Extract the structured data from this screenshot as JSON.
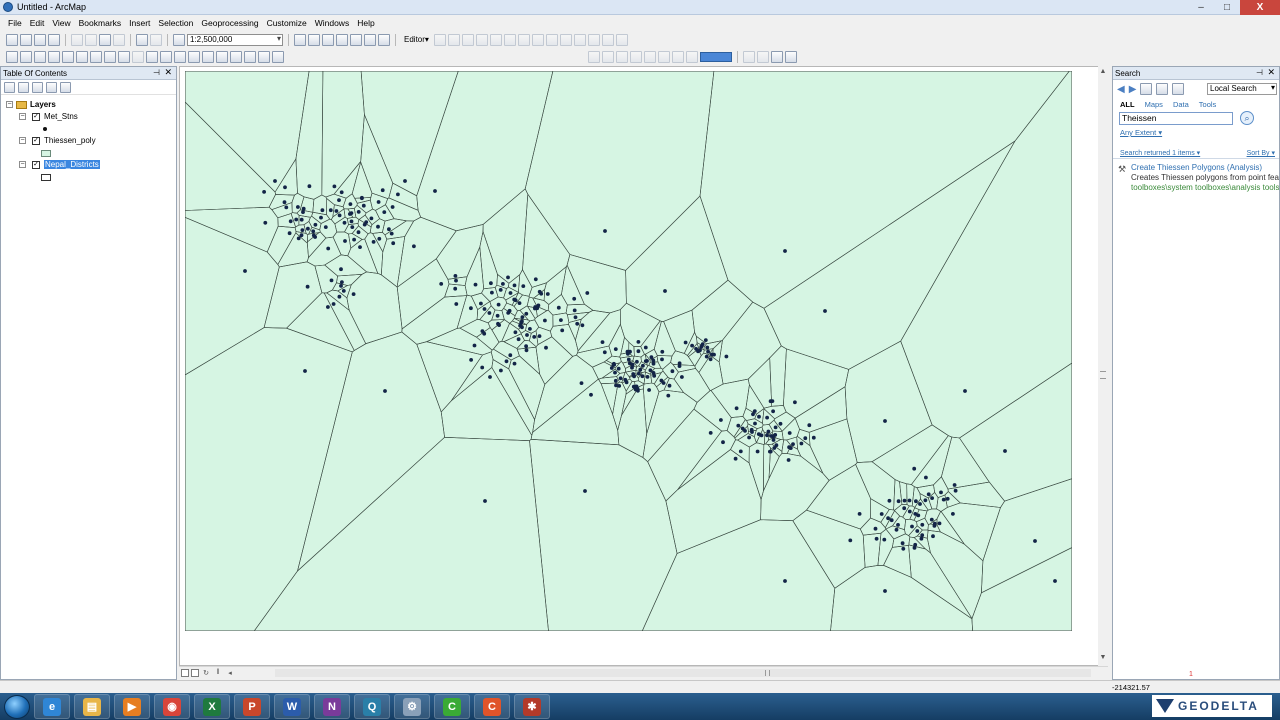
{
  "window": {
    "title": "Untitled - ArcMap",
    "minimize": "–",
    "maximize": "□",
    "close": "X"
  },
  "menu": [
    "File",
    "Edit",
    "View",
    "Bookmarks",
    "Insert",
    "Selection",
    "Geoprocessing",
    "Customize",
    "Windows",
    "Help"
  ],
  "toolbar": {
    "scale": "1:2,500,000",
    "editor": "Editor▾"
  },
  "toc": {
    "title": "Table Of Contents",
    "root": "Layers",
    "layers": [
      {
        "name": "Met_Stns",
        "checked": "✓",
        "expander": "−"
      },
      {
        "name": "Thiessen_poly",
        "checked": "✓",
        "expander": "−"
      },
      {
        "name": "Nepal_Districts",
        "checked": "✓",
        "expander": "−"
      }
    ],
    "pin": "⊣",
    "close": "✕"
  },
  "map": {
    "fill_color": "#d6f5e3",
    "line_color": "#3c4c44",
    "point_color": "#132447"
  },
  "search": {
    "title": "Search",
    "scope": "Local Search",
    "tabs": [
      "ALL",
      "Maps",
      "Data",
      "Tools"
    ],
    "query": "Theissen",
    "go_icon": "⌕",
    "extent": "Any Extent ▾",
    "returned": "Search returned 1 items ▾",
    "sortby": "Sort By ▾",
    "result": {
      "title": "Create Thiessen Polygons (Analysis)",
      "description": "Creates Thiessen polygons from point features.",
      "path": "toolboxes\\system toolboxes\\analysis tools.tbx"
    }
  },
  "status": {
    "coords": "-214321.57",
    "marker": "1"
  },
  "taskbar": {
    "apps": [
      {
        "name": "ie",
        "glyph": "e",
        "color": "#2f86d6"
      },
      {
        "name": "explorer",
        "glyph": "▤",
        "color": "#e8b548"
      },
      {
        "name": "media",
        "glyph": "▶",
        "color": "#e67e22"
      },
      {
        "name": "chrome",
        "glyph": "◉",
        "color": "#d9453a"
      },
      {
        "name": "excel",
        "glyph": "X",
        "color": "#1f7a3e"
      },
      {
        "name": "powerpoint",
        "glyph": "P",
        "color": "#c9472b"
      },
      {
        "name": "word",
        "glyph": "W",
        "color": "#2b5cab"
      },
      {
        "name": "onenote",
        "glyph": "N",
        "color": "#7a3b9a"
      },
      {
        "name": "search-tool",
        "glyph": "Q",
        "color": "#2a7fa8"
      },
      {
        "name": "arccatalog",
        "glyph": "⚙",
        "color": "#8aa0b8"
      },
      {
        "name": "camtasia",
        "glyph": "C",
        "color": "#3aaa35"
      },
      {
        "name": "camtasia-recorder",
        "glyph": "C",
        "color": "#e0542a"
      },
      {
        "name": "arcmap",
        "glyph": "✱",
        "color": "#b33a2a"
      }
    ],
    "brand": "GEODELTA"
  }
}
